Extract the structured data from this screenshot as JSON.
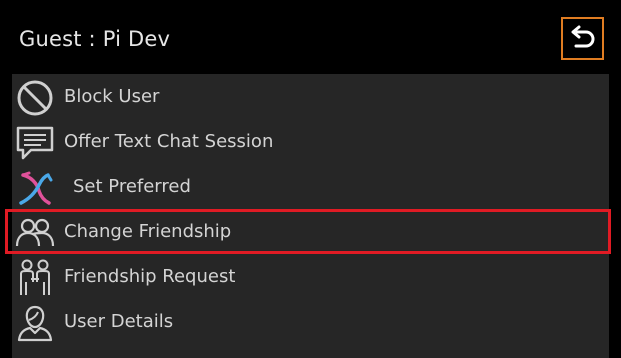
{
  "header": {
    "title": "Guest : Pi Dev",
    "back_icon": "back-arrow-icon",
    "accent_color": "#e07d22"
  },
  "menu": {
    "items": [
      {
        "label": "Block User",
        "icon": "block-icon"
      },
      {
        "label": "Offer Text Chat Session",
        "icon": "chat-bubble-icon"
      },
      {
        "label": "Set Preferred",
        "icon": "preferred-crossed-icon"
      },
      {
        "label": "Change Friendship",
        "icon": "friends-icon"
      },
      {
        "label": "Friendship Request",
        "icon": "friendship-request-icon"
      },
      {
        "label": "User Details",
        "icon": "user-details-icon"
      }
    ],
    "selected_label": "Change Friendship",
    "selection_color": "#e01b24"
  }
}
